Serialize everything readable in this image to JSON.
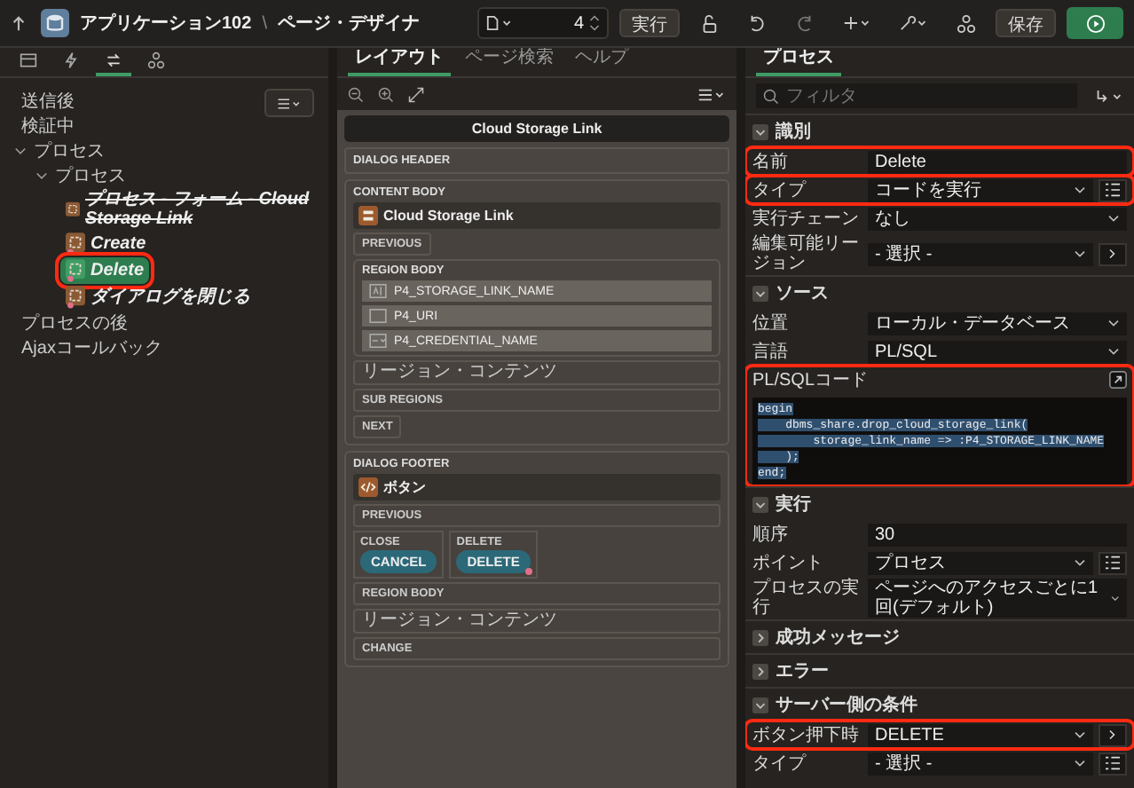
{
  "header": {
    "app_title": "アプリケーション102",
    "separator": "\\",
    "page_title": "ページ・デザイナ",
    "page_number": "4",
    "run_label": "実行",
    "save_label": "保存"
  },
  "left_panel": {
    "tabs": [
      {
        "kind": "rendering",
        "selected": false
      },
      {
        "kind": "dynamic",
        "selected": false
      },
      {
        "kind": "processing",
        "selected": true
      },
      {
        "kind": "shared",
        "selected": false
      }
    ],
    "tree": [
      {
        "label": "送信後",
        "kind": "group"
      },
      {
        "label": "検証中",
        "kind": "group"
      },
      {
        "label": "プロセス",
        "kind": "group",
        "expanded": true,
        "children": [
          {
            "label": "プロセス",
            "kind": "group",
            "expanded": true,
            "children": [
              {
                "label": "プロセス - フォーム - Cloud Storage Link",
                "kind": "process",
                "disabled": true,
                "condition": false,
                "selected": false,
                "highlighted": false
              },
              {
                "label": "Create",
                "kind": "process",
                "disabled": false,
                "condition": true,
                "selected": false,
                "highlighted": false
              },
              {
                "label": "Delete",
                "kind": "process",
                "disabled": false,
                "condition": true,
                "selected": true,
                "highlighted": true
              },
              {
                "label": "ダイアログを閉じる",
                "kind": "process",
                "disabled": false,
                "condition": true,
                "selected": false,
                "highlighted": false
              }
            ]
          }
        ]
      },
      {
        "label": "プロセスの後",
        "kind": "group"
      },
      {
        "label": "Ajaxコールバック",
        "kind": "group"
      }
    ]
  },
  "middle_panel": {
    "tabs": [
      {
        "label": "レイアウト",
        "selected": true
      },
      {
        "label": "ページ検索",
        "selected": false
      },
      {
        "label": "ヘルプ",
        "selected": false
      }
    ],
    "layout": {
      "page_title": "Cloud Storage Link",
      "dialog_header": "DIALOG HEADER",
      "content_body": {
        "label": "CONTENT BODY",
        "region": {
          "title": "Cloud Storage Link",
          "kind": "form",
          "previous": "PREVIOUS",
          "region_body": "REGION BODY",
          "items": [
            {
              "name": "P4_STORAGE_LINK_NAME",
              "kind": "text"
            },
            {
              "name": "P4_URI",
              "kind": "hidden"
            },
            {
              "name": "P4_CREDENTIAL_NAME",
              "kind": "select"
            }
          ],
          "content": "リージョン・コンテンツ",
          "sub_regions": "SUB REGIONS",
          "next": "NEXT"
        }
      },
      "dialog_footer": {
        "label": "DIALOG FOOTER",
        "region": {
          "title": "ボタン",
          "kind": "buttons",
          "previous": "PREVIOUS",
          "slots": [
            {
              "label": "CLOSE",
              "button": "CANCEL",
              "condition": false
            },
            {
              "label": "DELETE",
              "button": "DELETE",
              "condition": true
            }
          ],
          "region_body": "REGION BODY",
          "content": "リージョン・コンテンツ",
          "change": "CHANGE"
        }
      }
    }
  },
  "right_panel": {
    "tab": "プロセス",
    "filter": {
      "placeholder": "フィルタ"
    },
    "sections": [
      {
        "title": "識別",
        "expanded": true,
        "rows": [
          {
            "label": "名前",
            "kind": "text",
            "value": "Delete",
            "highlighted": true
          },
          {
            "label": "タイプ",
            "kind": "select",
            "value": "コードを実行",
            "list_button": true,
            "highlighted": true
          },
          {
            "label": "実行チェーン",
            "kind": "select",
            "value": "なし",
            "highlighted": false
          },
          {
            "label": "編集可能リージョン",
            "kind": "select",
            "value": "- 選択 -",
            "arrow_button": true,
            "highlighted": false
          }
        ]
      },
      {
        "title": "ソース",
        "expanded": true,
        "rows": [
          {
            "label": "位置",
            "kind": "select",
            "value": "ローカル・データベース",
            "highlighted": false
          },
          {
            "label": "言語",
            "kind": "select",
            "value": "PL/SQL",
            "highlighted": false
          },
          {
            "label": "PL/SQLコード",
            "kind": "code",
            "selected": true,
            "highlighted": true,
            "lines": [
              "begin",
              "    dbms_share.drop_cloud_storage_link(",
              "        storage_link_name => :P4_STORAGE_LINK_NAME",
              "    );",
              "end;"
            ]
          }
        ]
      },
      {
        "title": "実行",
        "expanded": true,
        "rows": [
          {
            "label": "順序",
            "kind": "text",
            "value": "30",
            "highlighted": false
          },
          {
            "label": "ポイント",
            "kind": "select",
            "value": "プロセス",
            "list_button": true,
            "highlighted": false
          },
          {
            "label": "プロセスの実行",
            "kind": "select",
            "value": "ページへのアクセスごとに1回(デフォルト)",
            "highlighted": false
          }
        ]
      },
      {
        "title": "成功メッセージ",
        "expanded": false
      },
      {
        "title": "エラー",
        "expanded": false
      },
      {
        "title": "サーバー側の条件",
        "expanded": true,
        "rows": [
          {
            "label": "ボタン押下時",
            "kind": "select",
            "value": "DELETE",
            "arrow_button": true,
            "highlighted": true
          },
          {
            "label": "タイプ",
            "kind": "select",
            "value": "- 選択 -",
            "list_button": true,
            "highlighted": false
          }
        ]
      }
    ]
  }
}
